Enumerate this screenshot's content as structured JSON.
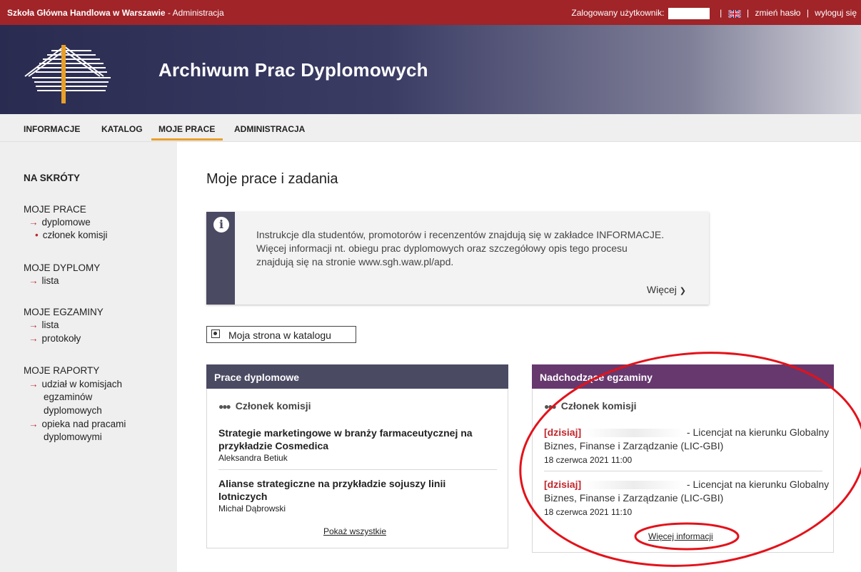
{
  "topbar": {
    "university": "Szkoła Główna Handlowa w Warszawie",
    "context": " - Administracja",
    "logged_in_label": "Zalogowany użytkownik:",
    "change_password": "zmień hasło",
    "logout": "wyloguj się"
  },
  "banner": {
    "title": "Archiwum Prac Dyplomowych"
  },
  "nav": {
    "items": [
      "INFORMACJE",
      "KATALOG",
      "MOJE PRACE",
      "ADMINISTRACJA"
    ],
    "active": "MOJE PRACE"
  },
  "sidebar": {
    "heading": "NA SKRÓTY",
    "moje_prace": {
      "title": "MOJE PRACE",
      "link1": "dyplomowe",
      "sub1": "członek komisji"
    },
    "moje_dyplomy": {
      "title": "MOJE DYPLOMY",
      "link1": "lista"
    },
    "moje_egzaminy": {
      "title": "MOJE EGZAMINY",
      "link1": "lista",
      "link2": "protokoły"
    },
    "moje_raporty": {
      "title": "MOJE RAPORTY",
      "link1_l1": "udział w komisjach",
      "link1_l2": "egzaminów",
      "link1_l3": "dyplomowych",
      "link2_l1": "opieka nad pracami",
      "link2_l2": "dyplomowymi"
    }
  },
  "main": {
    "title": "Moje prace i zadania",
    "info": {
      "line1": "Instrukcje dla studentów, promotorów i recenzentów znajdują się w zakładce INFORMACJE.",
      "line2": "Więcej informacji nt. obiegu prac dyplomowych oraz szczegółowy opis tego procesu",
      "line3": "znajdują się na stronie www.sgh.waw.pl/apd.",
      "more": "Więcej"
    },
    "catalog_button": "Moja strona w katalogu"
  },
  "theses_card": {
    "header": "Prace dyplomowe",
    "role": "Członek komisji",
    "items": [
      {
        "title_l1": "Strategie marketingowe w branży farmaceutycznej na",
        "title_l2": "przykładzie Cosmedica",
        "author": "Aleksandra Betiuk"
      },
      {
        "title_l1": "Alianse strategiczne na przykładzie sojuszy linii",
        "title_l2": "lotniczych",
        "author": "Michał Dąbrowski"
      }
    ],
    "show_all": "Pokaż wszystkie"
  },
  "exams_card": {
    "header": "Nadchodzące egzaminy",
    "role": "Członek komisji",
    "items": [
      {
        "today": "[dzisiaj]",
        "desc_l1": "- Licencjat na kierunku Globalny",
        "desc_l2": "Biznes, Finanse i Zarządzanie (LIC-GBI)",
        "date": "18 czerwca 2021 11:00"
      },
      {
        "today": "[dzisiaj]",
        "desc_l1": "- Licencjat na kierunku Globalny",
        "desc_l2": "Biznes, Finanse i Zarządzanie (LIC-GBI)",
        "date": "18 czerwca 2021 11:10"
      }
    ],
    "more_info": "Więcej informacji"
  },
  "colors": {
    "topbar": "#a02428",
    "theses_header": "#4a4a63",
    "exams_header": "#66386e",
    "accent_red": "#c0272d",
    "nav_active": "#e8a02a",
    "annotation": "#e3121a"
  }
}
